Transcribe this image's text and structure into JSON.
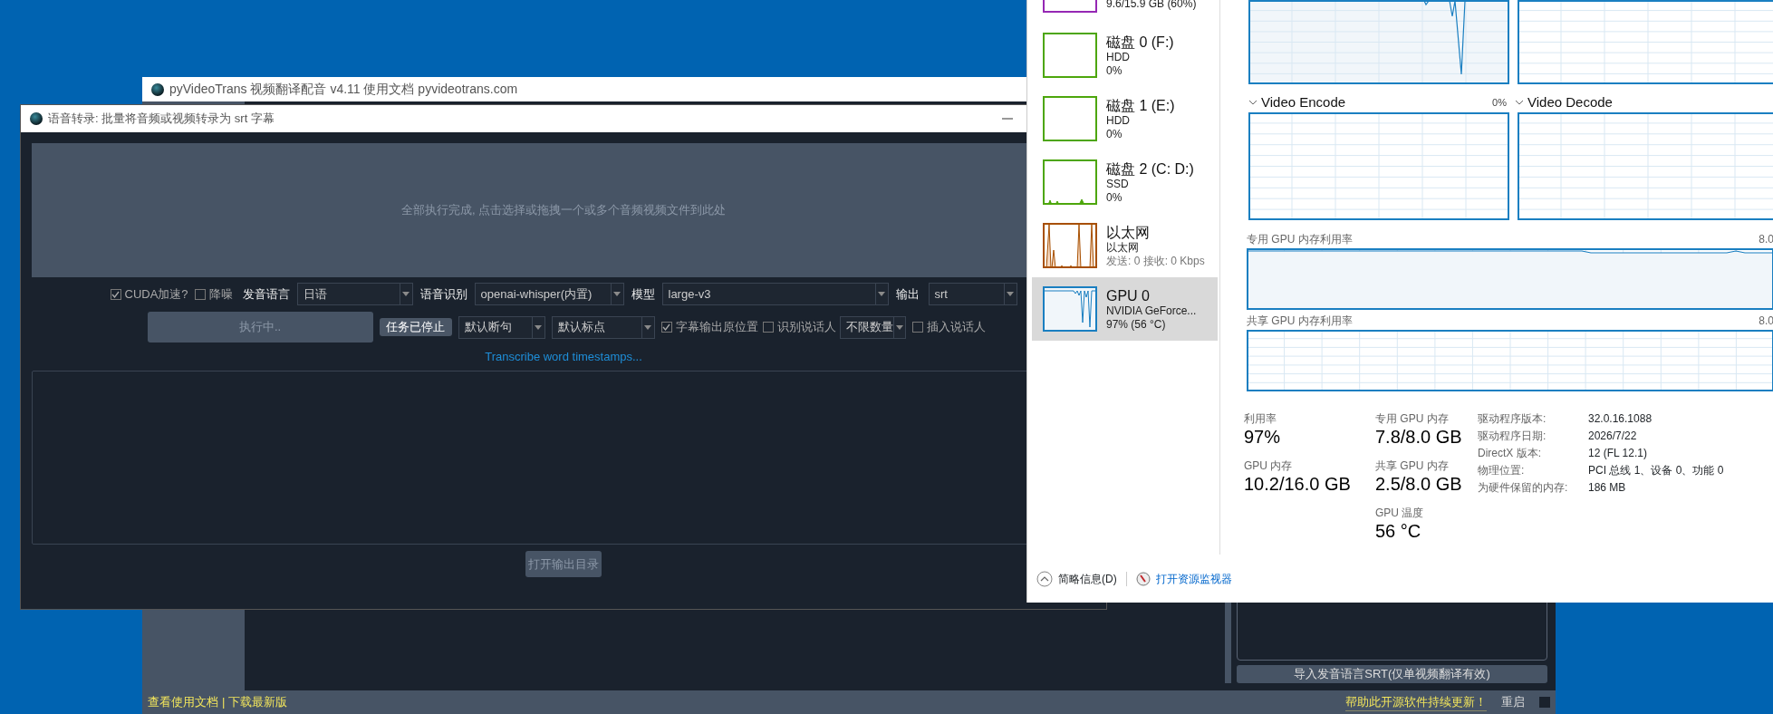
{
  "background_window": {
    "title": "pyVideoTrans 视频翻译配音 v4.11 使用文档 pyvideotrans.com",
    "srt_button": "导入发音语言SRT(仅单视频翻译有效)",
    "status_links": [
      "查看使用文档",
      "|",
      "下载最新版"
    ],
    "support_link": "帮助此开源软件持续更新！",
    "restart_button": "重启"
  },
  "transcribe_window": {
    "title": "语音转录: 批量将音频或视频转录为 srt 字幕",
    "drop_zone": "全部执行完成, 点击选择或拖拽一个或多个音频视频文件到此处",
    "row_1": [
      {
        "kind": "checkbox",
        "label": "CUDA加速?",
        "checked": true
      },
      {
        "kind": "checkbox",
        "label": "降噪",
        "checked": false
      },
      {
        "kind": "label",
        "text": "发音语言"
      },
      {
        "kind": "select",
        "value": "日语"
      },
      {
        "kind": "label",
        "text": "语音识别"
      },
      {
        "kind": "select",
        "value": "openai-whisper(内置)"
      },
      {
        "kind": "label",
        "text": "模型"
      },
      {
        "kind": "select",
        "value": "large-v3"
      },
      {
        "kind": "label",
        "text": "输出"
      },
      {
        "kind": "select",
        "value": "srt"
      }
    ],
    "row_2": [
      {
        "kind": "wide_button",
        "text": "执行中.."
      },
      {
        "kind": "button",
        "text": "任务已停止"
      },
      {
        "kind": "select",
        "value": "默认断句"
      },
      {
        "kind": "select",
        "value": "默认标点"
      },
      {
        "kind": "checkbox",
        "label": "字幕输出原位置",
        "checked": true
      },
      {
        "kind": "checkbox",
        "label": "识别说话人",
        "checked": false
      },
      {
        "kind": "select",
        "value": "不限数量"
      },
      {
        "kind": "checkbox",
        "label": "插入说话人",
        "checked": false
      }
    ],
    "link": "Transcribe word timestamps...",
    "open_folder_button": "打开输出目录"
  },
  "task_manager": {
    "devices": [
      {
        "reading": "9.6/15.9 GB (60%)",
        "color": "#9528b4",
        "selected": false
      },
      {
        "name": "磁盘 0 (F:)",
        "type": "HDD",
        "reading": "0%",
        "color": "#4da60c",
        "selected": false
      },
      {
        "name": "磁盘 1 (E:)",
        "type": "HDD",
        "reading": "0%",
        "color": "#4da60c",
        "selected": false
      },
      {
        "name": "磁盘 2 (C: D:)",
        "type": "SSD",
        "reading": "0%",
        "color": "#4da60c",
        "selected": false
      },
      {
        "name": "以太网",
        "type": "以太网",
        "reading": "发送: 0 接收: 0 Kbps",
        "color": "#a74f01",
        "selected": false
      },
      {
        "name": "GPU 0",
        "type": "NVIDIA GeForce...",
        "reading": "97% (56 °C)",
        "color": "#1a7fc1",
        "selected": true
      }
    ],
    "engines": [
      {
        "title": "Video Encode",
        "reading": "0%"
      },
      {
        "title": "Video Decode"
      }
    ],
    "memory_graphs": [
      {
        "title": "专用 GPU 内存利用率",
        "reading": "8.0"
      },
      {
        "title": "共享 GPU 内存利用率",
        "reading": "8.0"
      }
    ],
    "stats": [
      [
        {
          "label": "利用率",
          "value": "97%"
        },
        {
          "label": "GPU 内存",
          "value": "10.2/16.0 GB"
        }
      ],
      [
        {
          "label": "专用 GPU 内存",
          "value": "7.8/8.0 GB"
        },
        {
          "label": "共享 GPU 内存",
          "value": "2.5/8.0 GB"
        },
        {
          "label": "GPU 温度",
          "value": "56 °C"
        }
      ]
    ],
    "properties": [
      {
        "label": "驱动程序版本:",
        "value": "32.0.16.1088"
      },
      {
        "label": "驱动程序日期:",
        "value": "2026/7/22"
      },
      {
        "label": "DirectX 版本:",
        "value": "12 (FL 12.1)"
      },
      {
        "label": "物理位置:",
        "value": "PCI 总线 1、设备 0、功能 0"
      },
      {
        "label": "为硬件保留的内存:",
        "value": "186 MB"
      }
    ],
    "fewer_details": "简略信息(D)",
    "open_monitor": "打开资源监视器"
  }
}
